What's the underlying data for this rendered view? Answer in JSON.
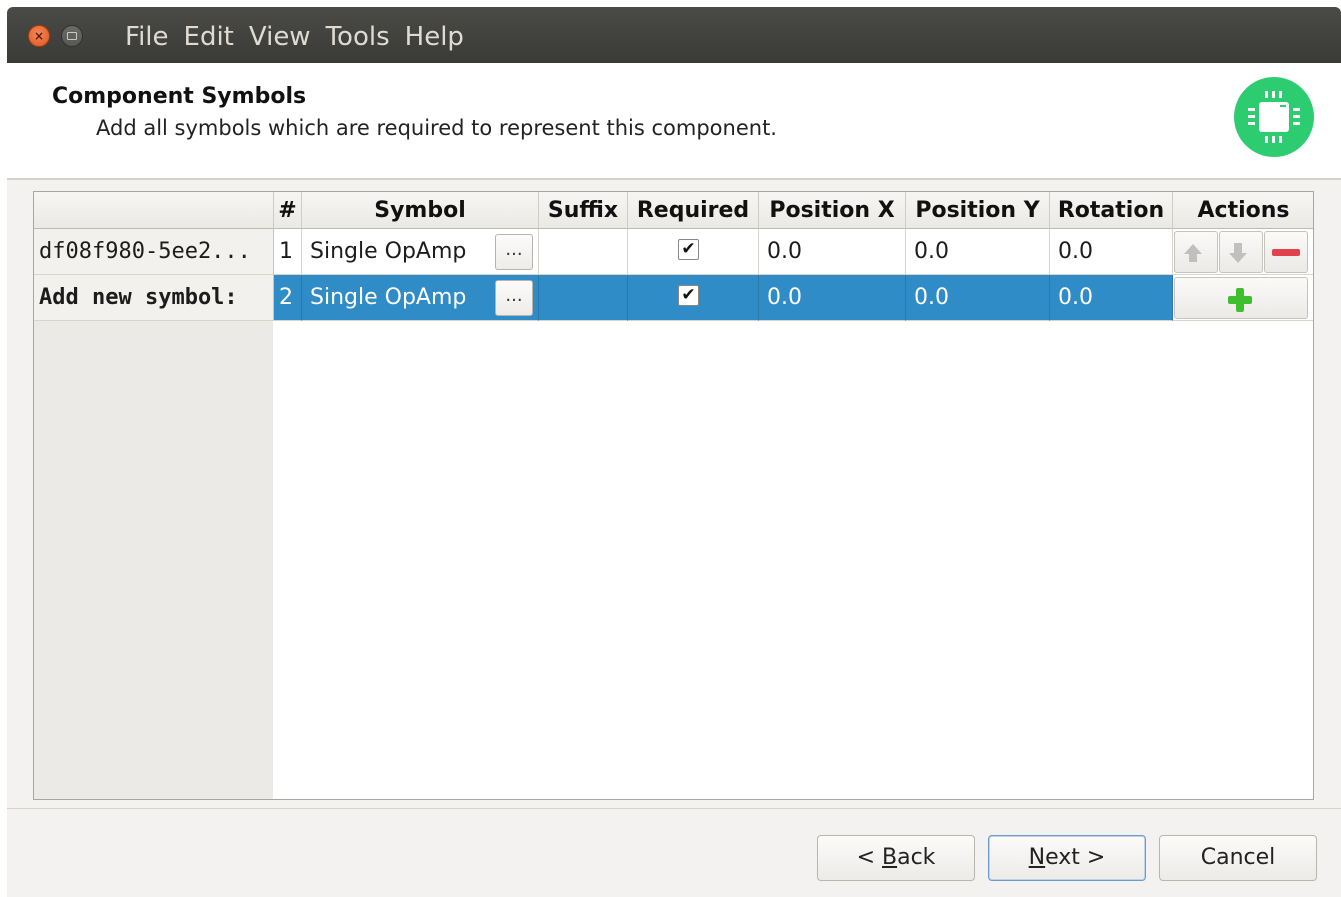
{
  "menubar": {
    "items": [
      "File",
      "Edit",
      "View",
      "Tools",
      "Help"
    ]
  },
  "header": {
    "title": "Component Symbols",
    "subtitle": "Add all symbols which are required to represent this component.",
    "icon": "chip-icon"
  },
  "table": {
    "columns": [
      "#",
      "Symbol",
      "Suffix",
      "Required",
      "Position X",
      "Position Y",
      "Rotation",
      "Actions"
    ],
    "rows": [
      {
        "row_header": "df08f980-5ee2...",
        "number": "1",
        "symbol": "Single OpAmp",
        "browse": "...",
        "suffix": "",
        "required": "✔",
        "position_x": "0.0",
        "position_y": "0.0",
        "rotation": "0.0"
      },
      {
        "row_header": "Add new symbol:",
        "number": "2",
        "symbol": "Single OpAmp",
        "browse": "...",
        "suffix": "",
        "required": "✔",
        "position_x": "0.0",
        "position_y": "0.0",
        "rotation": "0.0"
      }
    ]
  },
  "footer": {
    "back_prefix": "< ",
    "back_mnemonic": "B",
    "back_rest": "ack",
    "next_mnemonic": "N",
    "next_rest": "ext >",
    "cancel": "Cancel"
  },
  "colors": {
    "selection": "#308cc6",
    "icon_bg": "#2ecc71",
    "remove": "#e0434b",
    "add": "#3fbf2e"
  }
}
